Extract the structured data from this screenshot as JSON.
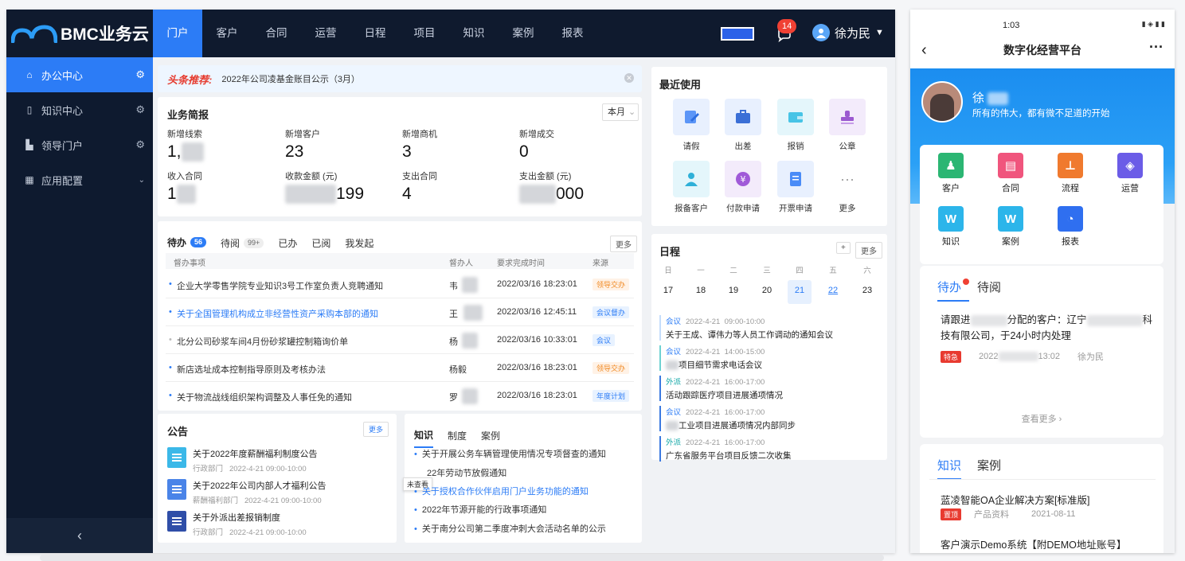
{
  "desktop": {
    "logo": "BMC业务云",
    "nav": [
      "门户",
      "客户",
      "合同",
      "运营",
      "日程",
      "项目",
      "知识",
      "案例",
      "报表"
    ],
    "notif_count": "14",
    "user": "徐为民",
    "sidebar": [
      {
        "label": "办公中心",
        "icon": "bank-icon"
      },
      {
        "label": "知识中心",
        "icon": "book-icon"
      },
      {
        "label": "领导门户",
        "icon": "chart-icon"
      },
      {
        "label": "应用配置",
        "icon": "grid-icon"
      }
    ],
    "collapse": "‹",
    "headline": {
      "tag": "头条推荐:",
      "text": "2022年公司凌基金账目公示（3月）"
    },
    "biz": {
      "title": "业务简报",
      "period": "本月",
      "kpis": [
        {
          "label": "新增线索",
          "value": "1,"
        },
        {
          "label": "新增客户",
          "value": "23"
        },
        {
          "label": "新增商机",
          "value": "3"
        },
        {
          "label": "新增成交",
          "value": "0"
        },
        {
          "label": "收入合同",
          "value": "1"
        },
        {
          "label": "收款金额 (元)",
          "value": "199"
        },
        {
          "label": "支出合同",
          "value": "4"
        },
        {
          "label": "支出金额 (元)",
          "value": "000"
        }
      ]
    },
    "todo": {
      "tabs": [
        {
          "label": "待办",
          "count": "56"
        },
        {
          "label": "待阅",
          "count": "99+"
        },
        {
          "label": "已办"
        },
        {
          "label": "已阅"
        },
        {
          "label": "我发起"
        }
      ],
      "more": "更多",
      "headers": [
        "督办事项",
        "督办人",
        "要求完成时间",
        "来源"
      ],
      "rows": [
        {
          "title": "企业大学零售学院专业知识3号工作室负责人竞聘通知",
          "person": "韦",
          "time": "2022/03/16 18:23:01",
          "src": "领导交办",
          "c": "o"
        },
        {
          "title": "关于全国管理机构成立非经营性资产采购本部的通知",
          "person": "王",
          "time": "2022/03/16 12:45:11",
          "src": "会议督办",
          "c": "b"
        },
        {
          "title": "北分公司砂浆车间4月份砂浆罐控制箱询价单",
          "person": "杨",
          "time": "2022/03/16 10:33:01",
          "src": "会议",
          "c": "b"
        },
        {
          "title": "新店选址成本控制指导原则及考核办法",
          "person": "杨毅",
          "time": "2022/03/16 18:23:01",
          "src": "领导交办",
          "c": "o"
        },
        {
          "title": "关于物流战线组织架构调整及人事任免的通知",
          "person": "罗",
          "time": "2022/03/16 18:23:01",
          "src": "年度计划",
          "c": "b"
        }
      ]
    },
    "announce": {
      "title": "公告",
      "more": "更多",
      "items": [
        {
          "title": "关于2022年度薪酬福利制度公告",
          "dept": "行政部门",
          "time": "2022-4-21  09:00-10:00"
        },
        {
          "title": "关于2022年公司内部人才福利公告",
          "dept": "薪酬福利部门",
          "time": "2022-4-21  09:00-10:00"
        },
        {
          "title": "关于外派出差报销制度",
          "dept": "行政部门",
          "time": "2022-4-21  09:00-10:00"
        }
      ]
    },
    "knowledge": {
      "tabs": [
        "知识",
        "制度",
        "案例"
      ],
      "tooltip": "未查看",
      "items": [
        "关于开展公务车辆管理使用情况专项督查的通知",
        "22年劳动节放假通知",
        "关于授权合作伙伴启用门户业务功能的通知",
        "2022年节源开能的行政事项通知",
        "关于南分公司第二季度冲刺大会活动名单的公示"
      ]
    },
    "recent": {
      "title": "最近使用",
      "items": [
        {
          "label": "请假",
          "bg": "#e8f0fe",
          "fg": "#4a8cf7"
        },
        {
          "label": "出差",
          "bg": "#e8f0fe",
          "fg": "#3b6fd6"
        },
        {
          "label": "报销",
          "bg": "#e4f6fb",
          "fg": "#3cbde0"
        },
        {
          "label": "公章",
          "bg": "#f3ebfb",
          "fg": "#9b59d0"
        },
        {
          "label": "报备客户",
          "bg": "#e4f6fb",
          "fg": "#2fb0d8"
        },
        {
          "label": "付款申请",
          "bg": "#f3ebfb",
          "fg": "#a05ad8"
        },
        {
          "label": "开票申请",
          "bg": "#e8f0fe",
          "fg": "#4a8cf7"
        },
        {
          "label": "更多",
          "bg": "#fff",
          "fg": "#999"
        }
      ]
    },
    "calendar": {
      "title": "日程",
      "add": "+",
      "more": "更多",
      "weekdays": [
        "日",
        "一",
        "二",
        "三",
        "四",
        "五",
        "六"
      ],
      "days": [
        "17",
        "18",
        "19",
        "20",
        "21",
        "22",
        "23"
      ],
      "events": [
        {
          "type": "会议",
          "date": "2022-4-21",
          "time": "09:00-10:00",
          "title": "关于王成、谭伟力等人员工作调动的通知会议"
        },
        {
          "type": "会议",
          "date": "2022-4-21",
          "time": "14:00-15:00",
          "title": "项目细节需求电话会议"
        },
        {
          "type": "外派",
          "date": "2022-4-21",
          "time": "16:00-17:00",
          "title": "活动跟踪医疗项目进展通项情况"
        },
        {
          "type": "会议",
          "date": "2022-4-21",
          "time": "16:00-17:00",
          "title": "工业项目进展通项情况内部同步"
        },
        {
          "type": "外派",
          "date": "2022-4-21",
          "time": "16:00-17:00",
          "title": "广东省服务平台项目反馈二次收集"
        }
      ]
    }
  },
  "mobile": {
    "time": "1:03",
    "title": "数字化经营平台",
    "name": "徐",
    "slogan": "所有的伟大，都有微不足道的开始",
    "apps": [
      {
        "label": "客户",
        "color": "#2bb673"
      },
      {
        "label": "合同",
        "color": "#f0557d"
      },
      {
        "label": "流程",
        "color": "#f07a2e"
      },
      {
        "label": "运营",
        "color": "#6b5ce7"
      },
      {
        "label": "知识",
        "color": "#2cb5ea"
      },
      {
        "label": "案例",
        "color": "#2cb5ea"
      },
      {
        "label": "报表",
        "color": "#2f6ff0"
      }
    ],
    "todo_tabs": [
      "待办",
      "待阅"
    ],
    "task": {
      "line1": "请跟进",
      "mid": "分配的客户：辽宁",
      "end": "科",
      "line2": "技有限公司，于24小时内处理",
      "tag": "特急",
      "date": "2022",
      "time": "13:02",
      "owner": "徐为民"
    },
    "see_more": "查看更多 ›",
    "kn_tabs": [
      "知识",
      "案例"
    ],
    "kn_items": [
      {
        "title": "蓝凌智能OA企业解决方案[标准版]",
        "tag": "置顶",
        "cat": "产品资料",
        "date": "2021-08-11"
      },
      {
        "title": "客户演示Demo系统【附DEMO地址账号】"
      }
    ]
  }
}
